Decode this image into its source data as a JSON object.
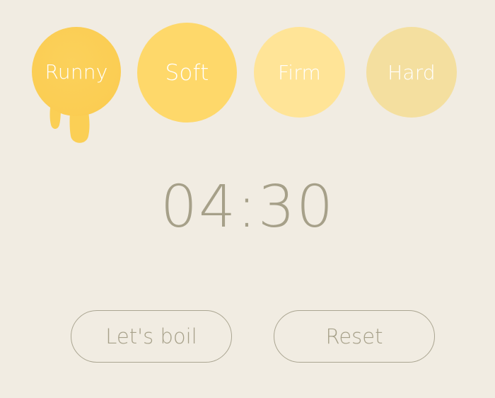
{
  "eggs": [
    {
      "id": "runny",
      "label": "Runny",
      "color": "#fbcf55"
    },
    {
      "id": "soft",
      "label": "Soft",
      "color": "#fed86a"
    },
    {
      "id": "firm",
      "label": "Firm",
      "color": "#ffe497"
    },
    {
      "id": "hard",
      "label": "Hard",
      "color": "#f4df9f"
    }
  ],
  "timer": {
    "display": "04:30"
  },
  "buttons": {
    "boil_label": "Let's boil",
    "reset_label": "Reset"
  },
  "colors": {
    "background": "#f1ece2",
    "text": "#a6a089",
    "outline": "#aaa591"
  }
}
